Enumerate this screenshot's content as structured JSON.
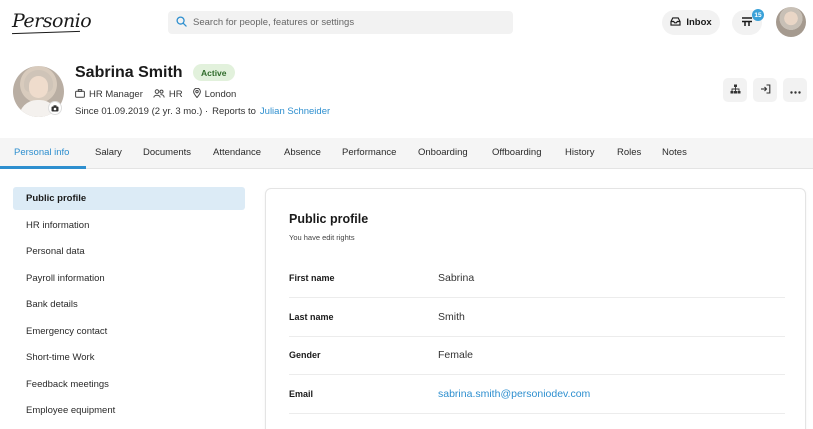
{
  "app": {
    "logo_text": "Personio"
  },
  "search": {
    "placeholder": "Search for people, features or settings"
  },
  "header_actions": {
    "inbox_label": "Inbox",
    "tasks_count": "15"
  },
  "profile": {
    "name": "Sabrina Smith",
    "status": "Active",
    "position": "HR Manager",
    "department": "HR",
    "location": "London",
    "since_text": "Since 01.09.2019 (2 yr. 3 mo.) ·",
    "reports_to_label": "Reports to",
    "reports_to_name": "Julian Schneider"
  },
  "tabs": [
    {
      "label": "Personal info",
      "active": true
    },
    {
      "label": "Salary"
    },
    {
      "label": "Documents"
    },
    {
      "label": "Attendance"
    },
    {
      "label": "Absence"
    },
    {
      "label": "Performance"
    },
    {
      "label": "Onboarding"
    },
    {
      "label": "Offboarding"
    },
    {
      "label": "History"
    },
    {
      "label": "Roles"
    },
    {
      "label": "Notes"
    }
  ],
  "sidebar": {
    "items": [
      {
        "label": "Public profile",
        "active": true
      },
      {
        "label": "HR information"
      },
      {
        "label": "Personal data"
      },
      {
        "label": "Payroll information"
      },
      {
        "label": "Bank details"
      },
      {
        "label": "Emergency contact"
      },
      {
        "label": "Short-time Work"
      },
      {
        "label": "Feedback meetings"
      },
      {
        "label": "Employee equipment"
      }
    ]
  },
  "section": {
    "title": "Public profile",
    "subtitle": "You have edit rights",
    "fields": [
      {
        "label": "First name",
        "value": "Sabrina"
      },
      {
        "label": "Last name",
        "value": "Smith"
      },
      {
        "label": "Gender",
        "value": "Female"
      },
      {
        "label": "Email",
        "value": "sabrina.smith@personiodev.com"
      }
    ]
  },
  "colors": {
    "accent": "#2e8fcf",
    "active_badge_bg": "#e2f1dc",
    "active_badge_text": "#2f6b2a",
    "nav_active_bg": "#dcebf6",
    "task_badge": "#3aa1d8"
  },
  "icons": {
    "search": "search-icon",
    "inbox": "inbox-icon",
    "tasks": "tasks-icon",
    "position": "briefcase-icon",
    "department": "team-icon",
    "location": "location-pin-icon",
    "camera": "camera-icon",
    "org_chart": "org-chart-icon",
    "login_as": "sign-in-icon",
    "more": "more-horizontal-icon"
  }
}
